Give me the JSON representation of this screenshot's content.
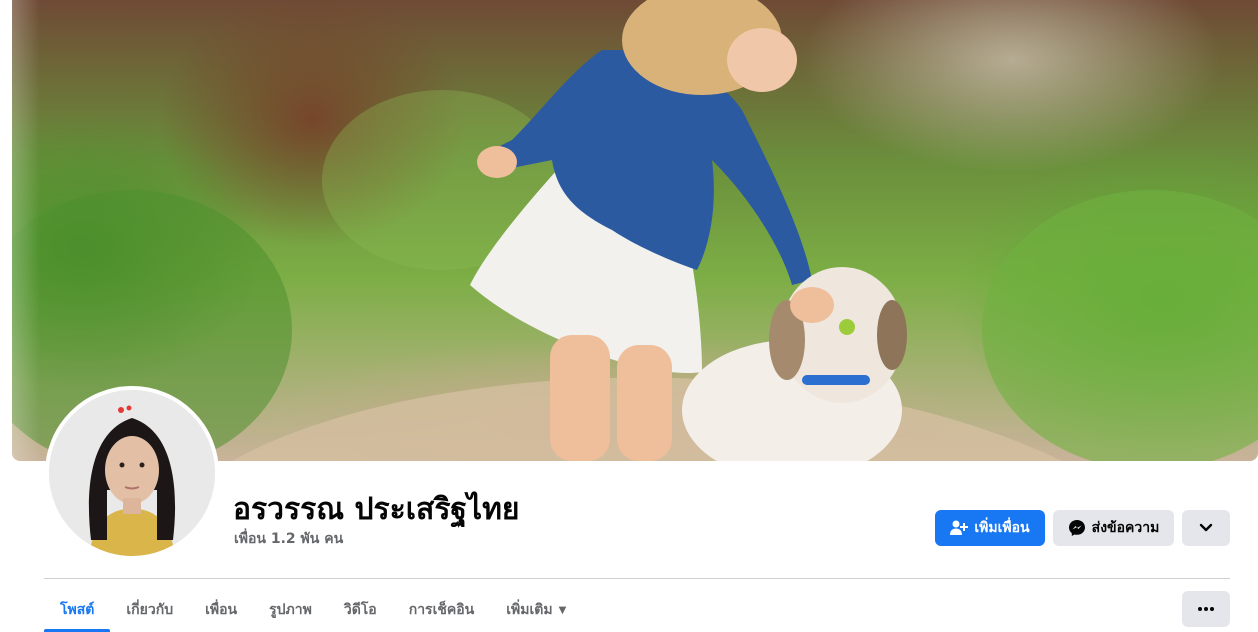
{
  "profile": {
    "name": "อรวรรณ ประเสริฐไทย",
    "friends_count": "เพื่อน 1.2 พัน คน",
    "cover_alt": "cover photo",
    "avatar_alt": "profile photo"
  },
  "actions": {
    "add_friend": "เพิ่มเพื่อน",
    "message": "ส่งข้อความ",
    "dropdown_icon": "chevron-down-icon",
    "more_icon": "ellipsis-icon"
  },
  "tabs": [
    {
      "label": "โพสต์",
      "active": true
    },
    {
      "label": "เกี่ยวกับ",
      "active": false
    },
    {
      "label": "เพื่อน",
      "active": false
    },
    {
      "label": "รูปภาพ",
      "active": false
    },
    {
      "label": "วิดีโอ",
      "active": false
    },
    {
      "label": "การเช็คอิน",
      "active": false
    },
    {
      "label": "เพิ่มเติม",
      "active": false
    }
  ],
  "colors": {
    "accent": "#1877f2",
    "button_gray": "#e4e6eb",
    "secondary_text": "#65676b"
  }
}
